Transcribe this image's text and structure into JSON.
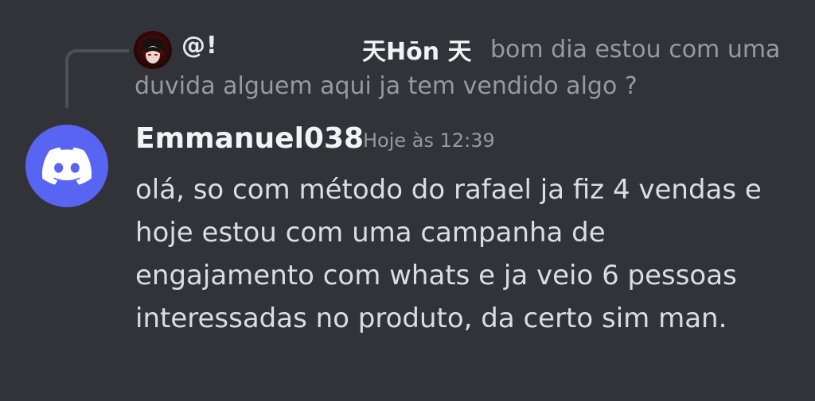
{
  "reply": {
    "author_prefix": "@!",
    "author_name": "天Hōn 天",
    "preview_line_1": "bom dia estou com uma",
    "preview_line_2": "duvida alguem aqui ja tem vendido algo ?"
  },
  "message": {
    "author": "Emmanuel038",
    "timestamp": "Hoje às 12:39",
    "lines": [
      "olá, so com método do rafael ja fiz 4 vendas e",
      "hoje estou com uma campanha de",
      "engajamento com whats e ja veio 6 pessoas",
      "interessadas no produto, da certo sim man."
    ]
  },
  "colors": {
    "background": "#313338",
    "avatar_blurple": "#5865f2",
    "muted_text": "#949ba4",
    "body_text": "#dbdee1"
  },
  "icons": {
    "main_avatar": "discord-logo-icon",
    "reply_avatar": "user-avatar-icon"
  }
}
